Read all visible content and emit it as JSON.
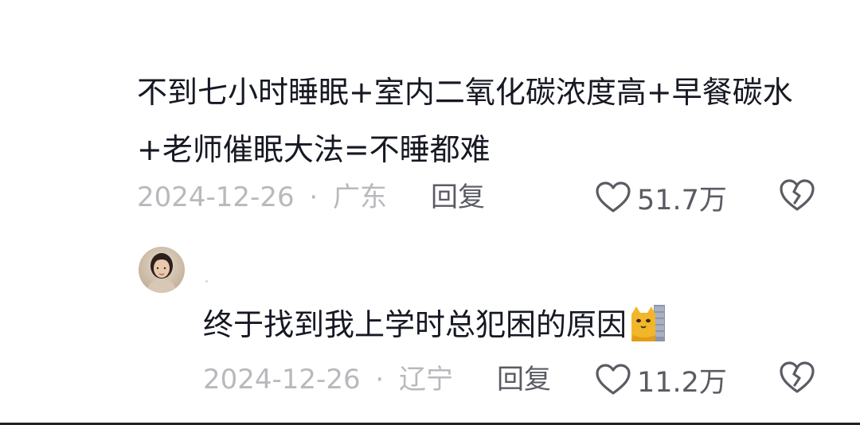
{
  "comments": [
    {
      "text": "不到七小时睡眠+室内二氧化碳浓度高+早餐碳水+老师催眠大法=不睡都难",
      "date": "2024-12-26",
      "separator": "·",
      "location": "广东",
      "reply_label": "回复",
      "likes": "51.7万",
      "like_icon": "heart-outline-icon",
      "dislike_icon": "broken-heart-icon"
    },
    {
      "avatar": "user-avatar",
      "text": "终于找到我上学时总犯困的原因",
      "emoji": "cat-peeking-emoji",
      "date": "2024-12-26",
      "separator": "·",
      "location": "辽宁",
      "reply_label": "回复",
      "likes": "11.2万",
      "like_icon": "heart-outline-icon",
      "dislike_icon": "broken-heart-icon"
    }
  ],
  "colors": {
    "text": "#161823",
    "meta": "#b9b9bd",
    "action": "#5a5b63"
  }
}
